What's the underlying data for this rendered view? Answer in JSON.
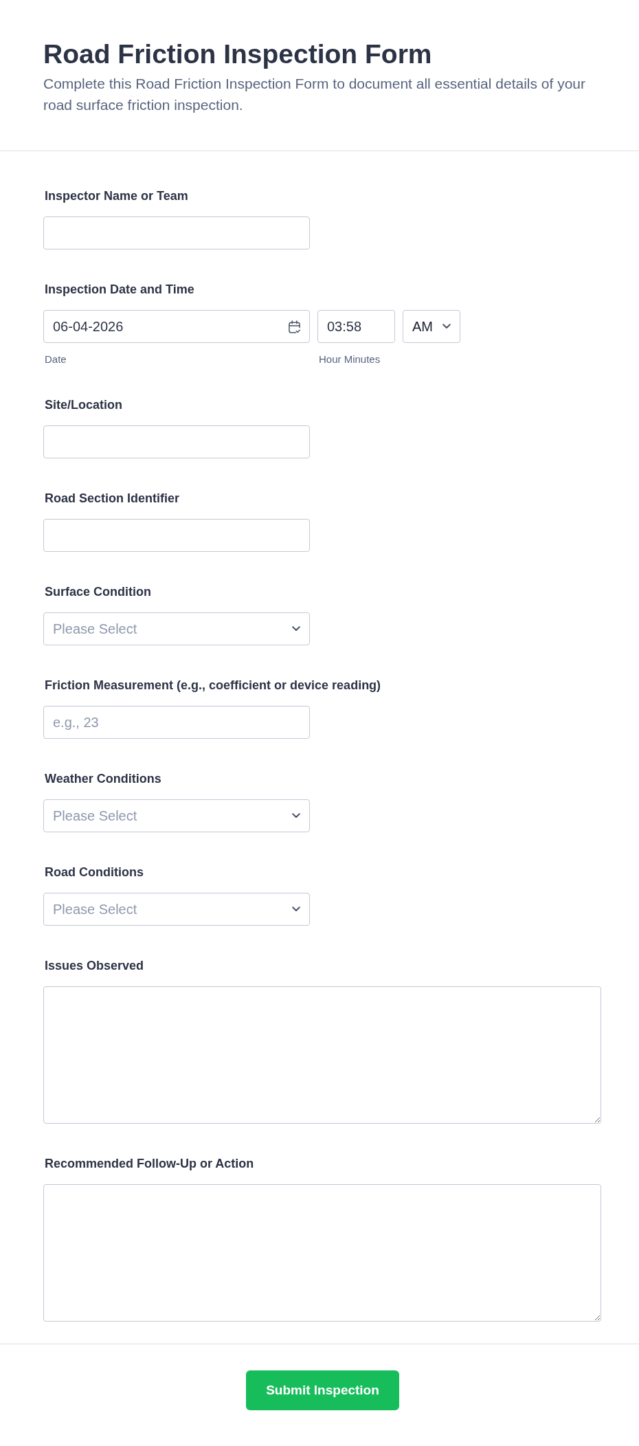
{
  "header": {
    "title": "Road Friction Inspection Form",
    "description": "Complete this Road Friction Inspection Form to document all essential details of your road surface friction inspection."
  },
  "fields": [
    {
      "kind": "text",
      "label": "Inspector Name or Team"
    },
    {
      "kind": "datetime",
      "label": "Inspection Date and Time",
      "date": {
        "value": "06-04-2026",
        "sublabel": "Date"
      },
      "time": {
        "value": "03:58",
        "sublabel": "Hour Minutes"
      },
      "period": {
        "value": "AM"
      }
    },
    {
      "kind": "text",
      "label": "Site/Location"
    },
    {
      "kind": "text",
      "label": "Road Section Identifier"
    },
    {
      "kind": "select",
      "label": "Surface Condition",
      "placeholder": "Please Select"
    },
    {
      "kind": "text",
      "label": "Friction Measurement (e.g., coefficient or device reading)",
      "placeholder": "e.g., 23"
    },
    {
      "kind": "select",
      "label": "Weather Conditions",
      "placeholder": "Please Select"
    },
    {
      "kind": "select",
      "label": "Road Conditions",
      "placeholder": "Please Select"
    },
    {
      "kind": "textarea",
      "label": "Issues Observed"
    },
    {
      "kind": "textarea",
      "label": "Recommended Follow-Up or Action"
    }
  ],
  "submit_button": {
    "label": "Submit Inspection"
  }
}
